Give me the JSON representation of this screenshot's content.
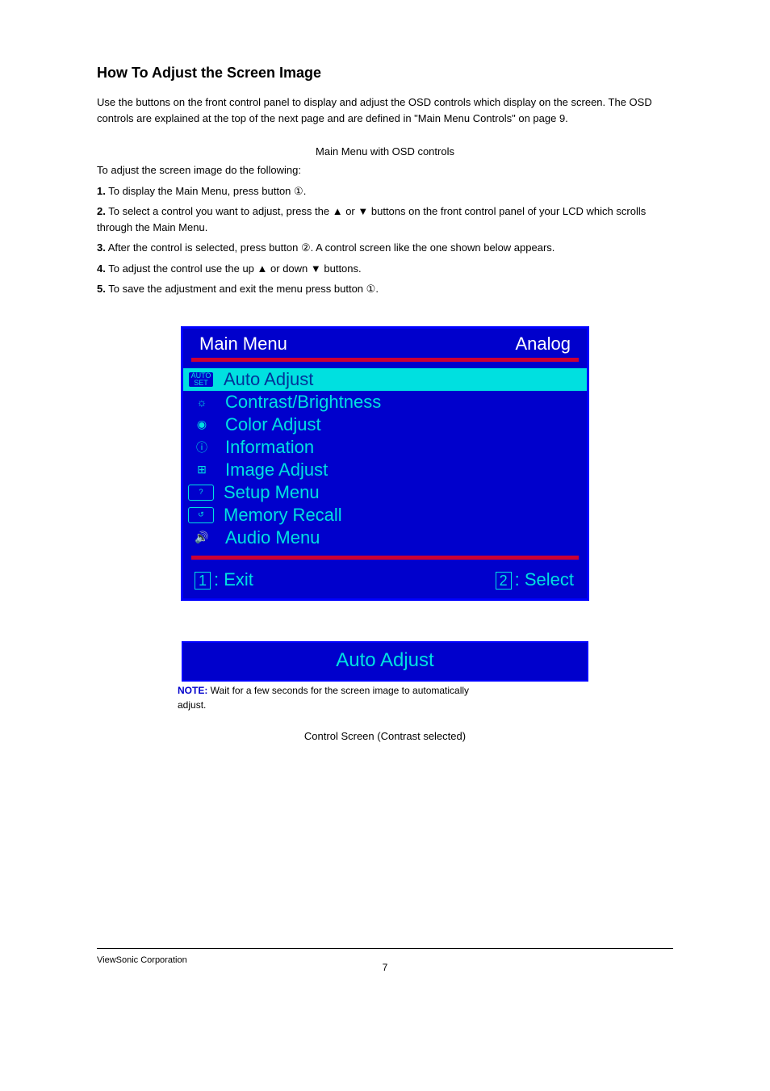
{
  "header_title": "How To Adjust the Screen Image",
  "intro": "Use the buttons on the front control panel to display and adjust the OSD controls which display on the screen. The OSD controls are explained at the top of the next page and are defined in \"Main Menu Controls\" on page 9.",
  "caption_main": "Main Menu with OSD controls",
  "steps_title": "To adjust the screen image do the following:",
  "step1_num": "1.",
  "step1_pre": "To display the Main Menu, press button ",
  "step1_sym": "①",
  "step1_post": ".",
  "step2_num": "2.",
  "step2_pre": "To select a control you want to adjust, press the ",
  "step2_up": "▲",
  "step2_mid1": " or ",
  "step2_down": "▼",
  "step2_post": " buttons on the front control panel of your LCD which scrolls through the Main Menu.",
  "step3_num": "3.",
  "step3_pre": "After the control is selected, press button ",
  "step3_sym": "②",
  "step3_post": ". A control screen like the one shown below appears.",
  "step4_num": "4.",
  "step4_pre": "To adjust the control use the up ",
  "step4_up": "▲",
  "step4_mid": " or down ",
  "step4_down": "▼",
  "step4_post": " buttons.",
  "step5_num": "5.",
  "step5_pre": "To save the adjustment and exit the menu press button ",
  "step5_sym": "①",
  "step5_post": ".",
  "osd": {
    "title": "Main Menu",
    "mode": "Analog",
    "items": [
      {
        "icon": "AUTO SET",
        "boxed": true,
        "label": "Auto Adjust",
        "selected": true
      },
      {
        "icon": "☼",
        "label": "Contrast/Brightness"
      },
      {
        "icon": "◉",
        "label": "Color Adjust"
      },
      {
        "icon": "ⓘ",
        "label": "Information"
      },
      {
        "icon": "⊞",
        "label": "Image Adjust"
      },
      {
        "icon": "?",
        "boxed": true,
        "label": "Setup Menu"
      },
      {
        "icon": "↺",
        "boxed": true,
        "label": "Memory Recall"
      },
      {
        "icon": "🔊",
        "label": "Audio Menu"
      }
    ],
    "exit_num": "1",
    "exit_label": ": Exit",
    "select_num": "2",
    "select_label": ": Select"
  },
  "auto_adjust_bar": "Auto Adjust",
  "note_label": "NOTE:",
  "note_line1": " Wait for a few seconds for the screen image to automatically",
  "note_line2": "adjust.",
  "caption_control": "Control Screen (Contrast selected)",
  "footer_text": "ViewSonic Corporation",
  "page_number": "7"
}
